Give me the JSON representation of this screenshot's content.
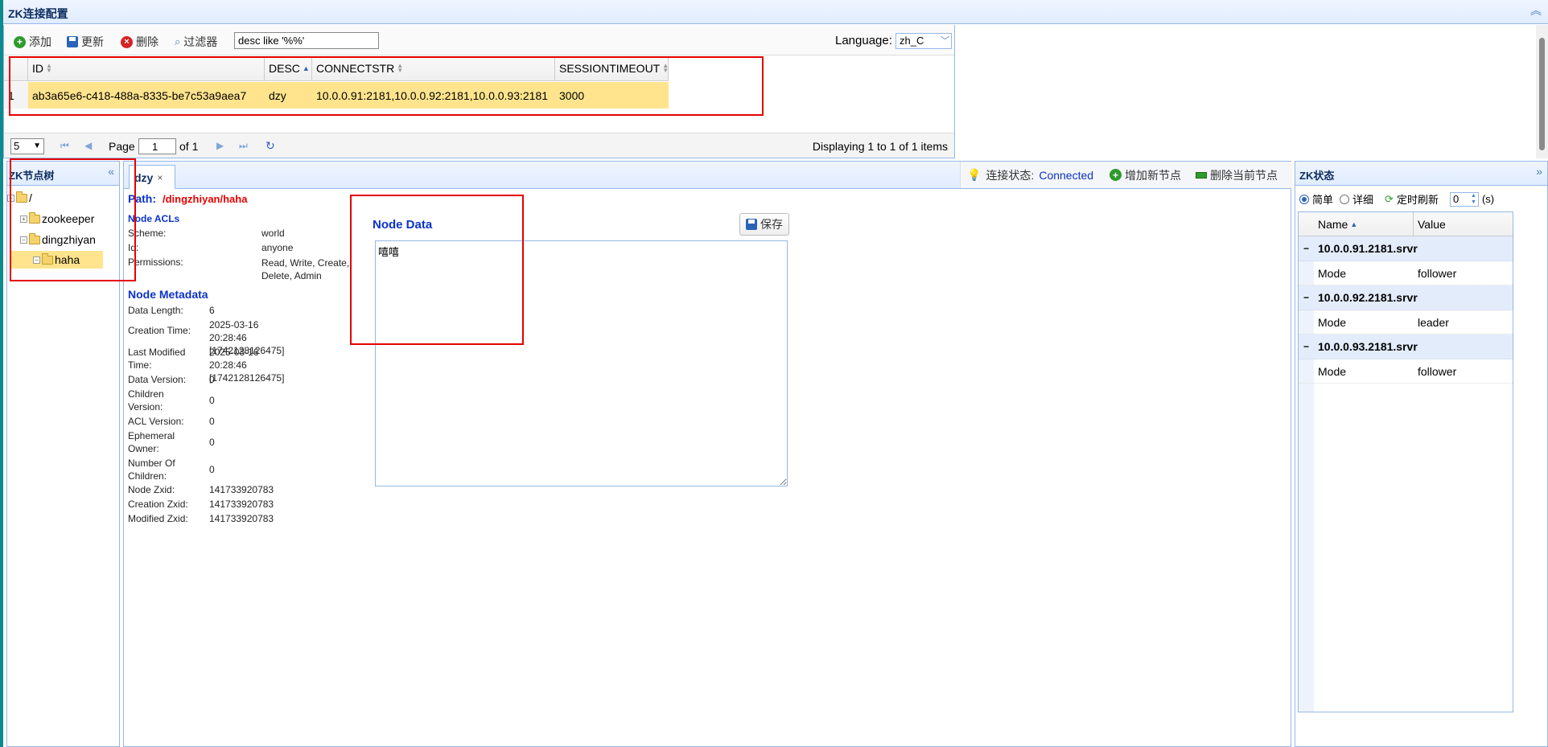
{
  "top_panel": {
    "title": "ZK连接配置",
    "toolbar": {
      "add_label": "添加",
      "update_label": "更新",
      "delete_label": "删除",
      "filter_label": "过滤器",
      "filter_value": "desc like '%%'",
      "language_label": "Language:",
      "language_value": "zh_C"
    },
    "grid": {
      "columns": [
        "ID",
        "DESC",
        "CONNECTSTR",
        "SESSIONTIMEOUT"
      ],
      "rows": [
        {
          "num": "1",
          "id": "ab3a65e6-c418-488a-8335-be7c53a9aea7",
          "desc": "dzy",
          "connectstr": "10.0.0.91:2181,10.0.0.92:2181,10.0.0.93:2181",
          "timeout": "3000"
        }
      ]
    },
    "pager": {
      "page_size": "5",
      "page_label": "Page",
      "page_value": "1",
      "of_label": "of 1",
      "display_text": "Displaying 1 to 1 of 1 items"
    }
  },
  "tree_panel": {
    "title": "ZK节点树",
    "nodes": [
      {
        "label": "/"
      },
      {
        "label": "zookeeper"
      },
      {
        "label": "dingzhiyan"
      },
      {
        "label": "haha"
      }
    ]
  },
  "center_panel": {
    "tab_label": "dzy",
    "tab_close": "×",
    "status_label": "连接状态:",
    "status_value": "Connected",
    "add_node_label": "增加新节点",
    "delete_node_label": "删除当前节点",
    "path_label": "Path:",
    "path_value": "/dingzhiyan/haha",
    "acls_title": "Node ACLs",
    "acls": [
      {
        "label": "Scheme:",
        "value": "world"
      },
      {
        "label": "Id:",
        "value": "anyone"
      },
      {
        "label": "Permissions:",
        "value": "Read, Write, Create, Delete, Admin"
      }
    ],
    "metadata_title": "Node Metadata",
    "metadata": [
      {
        "label": "Data Length:",
        "value": "6"
      },
      {
        "label": "Creation Time:",
        "value": "2025-03-16 20:28:46 [1742128126475]"
      },
      {
        "label": "Last Modified Time:",
        "value": "2025-03-16 20:28:46 [1742128126475]"
      },
      {
        "label": "Data Version:",
        "value": "0"
      },
      {
        "label": "Children Version:",
        "value": "0"
      },
      {
        "label": "ACL Version:",
        "value": "0"
      },
      {
        "label": "Ephemeral Owner:",
        "value": "0"
      },
      {
        "label": "Number Of Children:",
        "value": "0"
      },
      {
        "label": "Node Zxid:",
        "value": "141733920783"
      },
      {
        "label": "Creation Zxid:",
        "value": "141733920783"
      },
      {
        "label": "Modified Zxid:",
        "value": "141733920783"
      }
    ],
    "node_data_title": "Node Data",
    "save_label": "保存",
    "node_data_value": "嘻嘻"
  },
  "status_panel": {
    "title": "ZK状态",
    "radio_simple": "简单",
    "radio_detail": "详细",
    "refresh_label": "定时刷新",
    "refresh_value": "0",
    "refresh_unit": "(s)",
    "columns": [
      "Name",
      "Value"
    ],
    "groups": [
      {
        "name": "10.0.0.91.2181.srvr",
        "items": [
          {
            "name": "Mode",
            "value": "follower"
          }
        ]
      },
      {
        "name": "10.0.0.92.2181.srvr",
        "items": [
          {
            "name": "Mode",
            "value": "leader"
          }
        ]
      },
      {
        "name": "10.0.0.93.2181.srvr",
        "items": [
          {
            "name": "Mode",
            "value": "follower"
          }
        ]
      }
    ]
  },
  "colors": {
    "header_border": "#95b8e7",
    "selected_row": "#ffe48d",
    "annotation_red": "#e60000",
    "title_blue": "#0b33c9"
  }
}
